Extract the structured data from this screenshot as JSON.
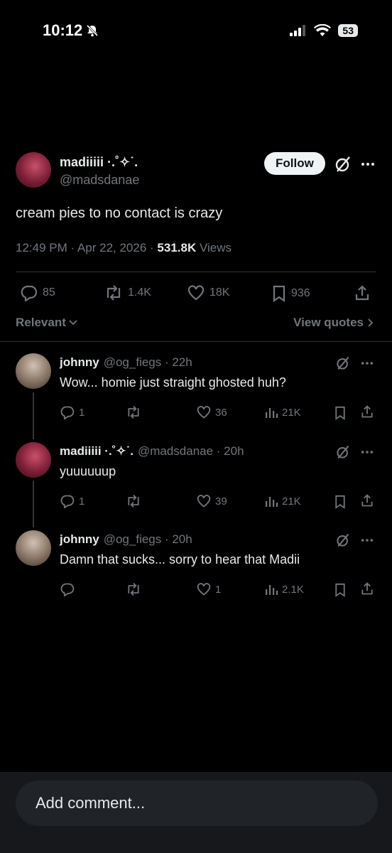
{
  "status_bar": {
    "time": "10:12",
    "battery": "53"
  },
  "tweet": {
    "name": "madiiiii ·.˚✧˙.",
    "handle": "@madsdanae",
    "follow_label": "Follow",
    "text": "cream pies to no contact is crazy",
    "time": "12:49 PM · Apr 22, 2026 · ",
    "views_count": "531.8K",
    "views_label": " Views",
    "replies": "85",
    "retweets": "1.4K",
    "likes": "18K",
    "bookmarks": "936"
  },
  "sort": {
    "label": "Relevant",
    "view_quotes": "View quotes"
  },
  "replies": [
    {
      "name": "johnny",
      "handle": "@og_fiegs · 22h",
      "text": "Wow... homie just straight ghosted huh?",
      "replies": "1",
      "retweets": "",
      "likes": "36",
      "views": "21K"
    },
    {
      "name": "madiiiii ·.˚✧˙.",
      "handle": "@madsdanae · 20h",
      "text": "yuuuuuup",
      "replies": "1",
      "retweets": "",
      "likes": "39",
      "views": "21K"
    },
    {
      "name": "johnny",
      "handle": "@og_fiegs · 20h",
      "text": "Damn that sucks... sorry to hear that Madii",
      "replies": "",
      "retweets": "",
      "likes": "1",
      "views": "2.1K"
    }
  ],
  "composer": {
    "placeholder": "Add comment..."
  },
  "colors": {
    "background": "#000000",
    "text": "#e7e9ea",
    "muted": "#71767b",
    "divider": "#2f3336"
  }
}
